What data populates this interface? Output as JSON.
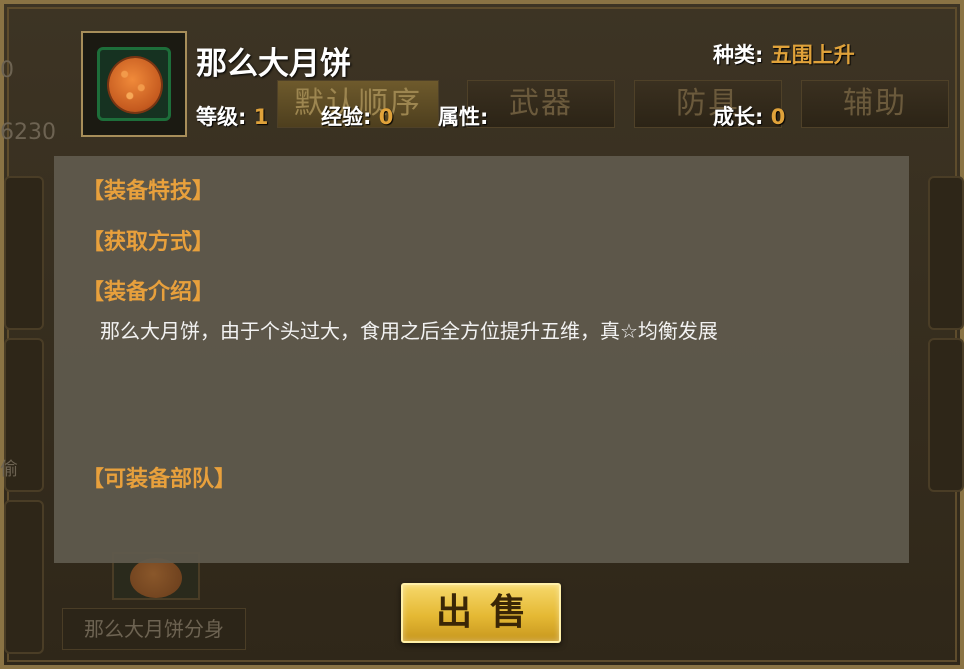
{
  "background": {
    "number_top": "0",
    "number_second": "6230",
    "side_glyph": "偷",
    "tabs": [
      {
        "label": "默认顺序",
        "active": true
      },
      {
        "label": "武器",
        "active": false
      },
      {
        "label": "防具",
        "active": false
      },
      {
        "label": "辅助",
        "active": false
      }
    ],
    "item_label": "那么大月饼分身"
  },
  "item": {
    "icon": "mooncake-icon",
    "name": "那么大月饼",
    "level_label": "等级:",
    "level_value": "1",
    "exp_label": "经验:",
    "exp_value": "0",
    "attr_label": "属性:",
    "growth_label": "成长:",
    "growth_value": "0",
    "type_label": "种类:",
    "type_value": "五围上升"
  },
  "description": {
    "section_skills": "【装备特技】",
    "section_obtain": "【获取方式】",
    "section_intro": "【装备介绍】",
    "intro_text": "那么大月饼，由于个头过大，食用之后全方位提升五维，真☆均衡发展",
    "section_units": "【可装备部队】"
  },
  "actions": {
    "sell_label": "出售"
  },
  "colors": {
    "accent": "#e0a23a",
    "section_heading": "#e8a03c",
    "button_gold": "#e5b934"
  }
}
